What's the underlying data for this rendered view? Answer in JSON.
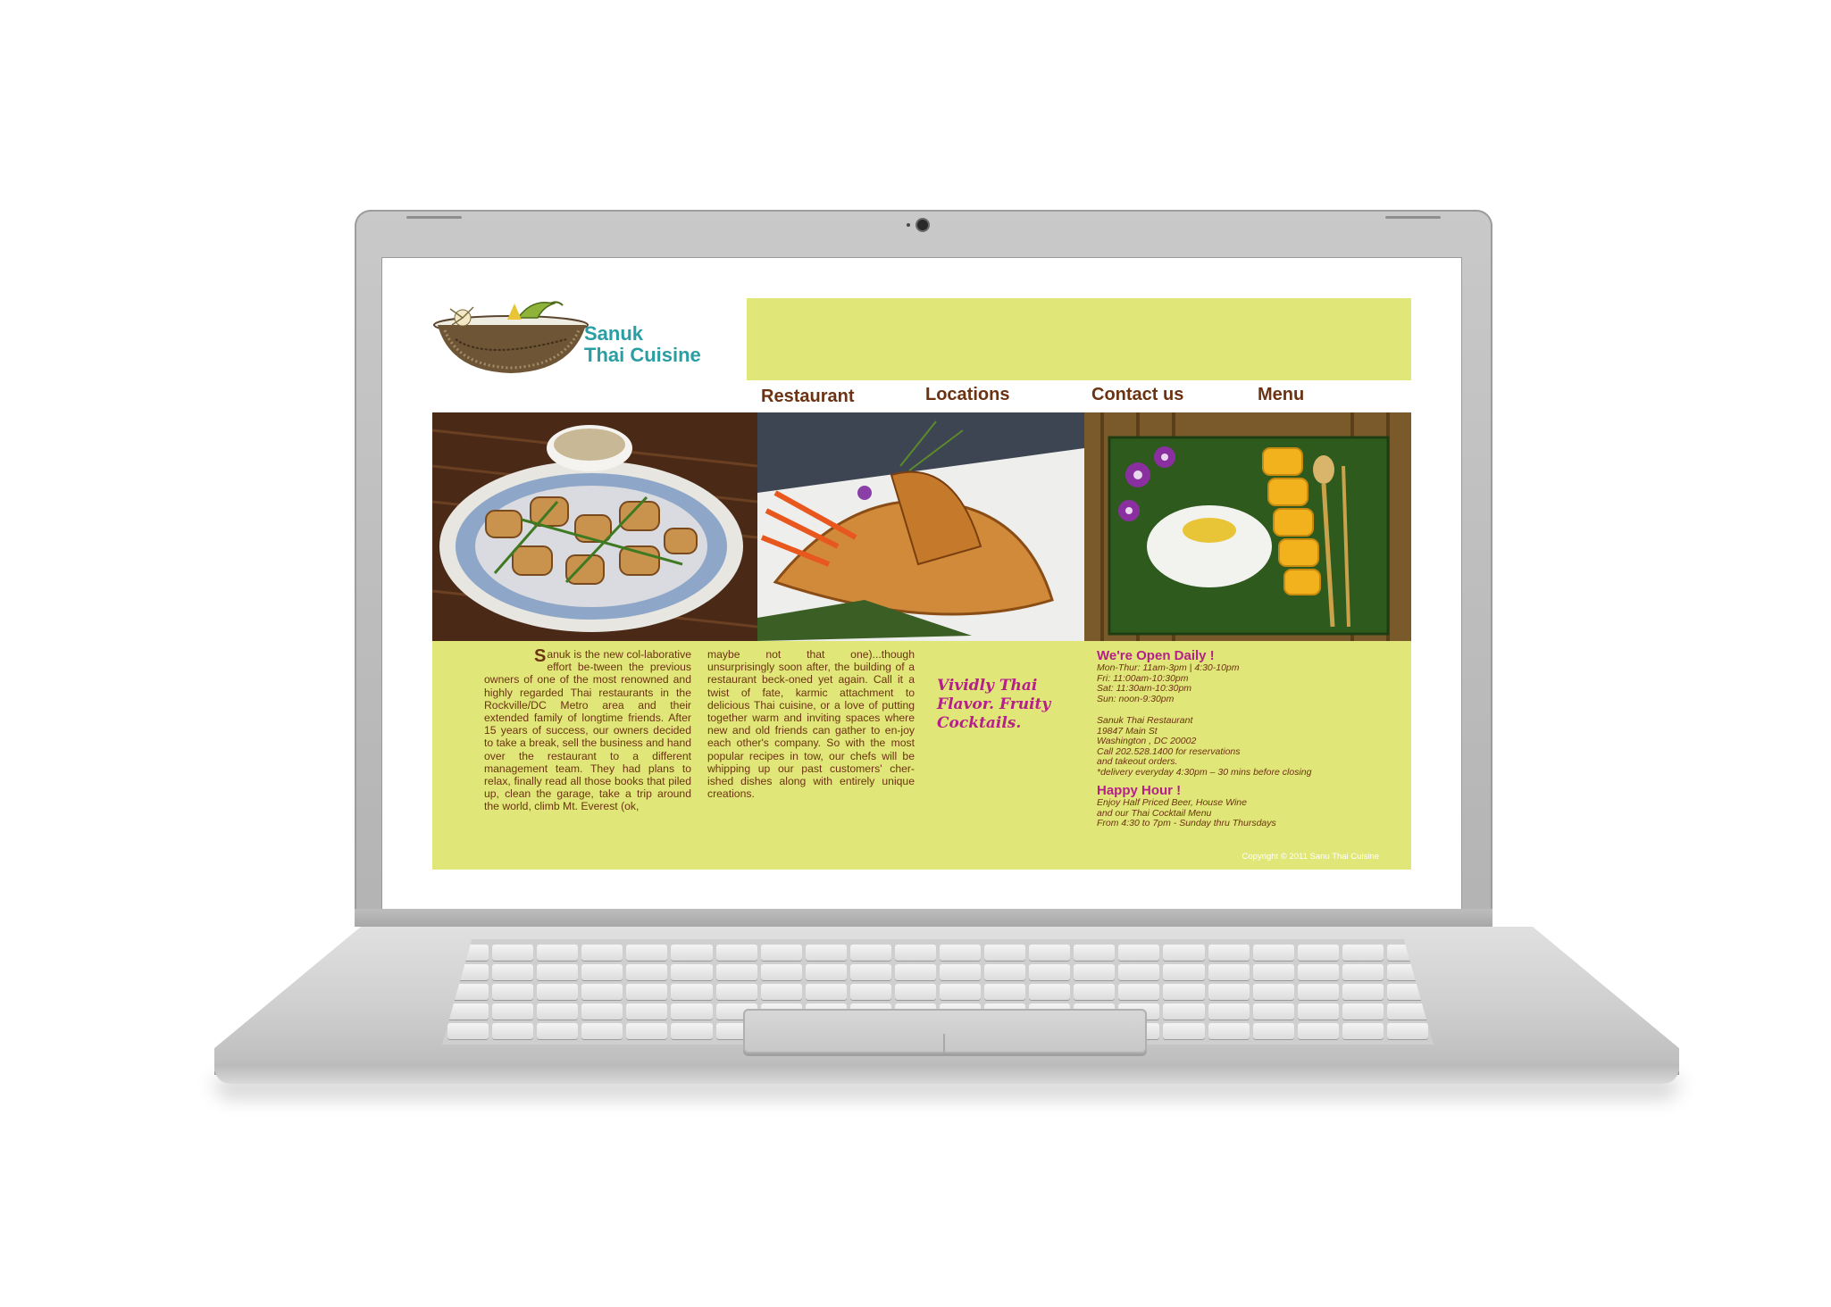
{
  "site": {
    "logo": {
      "line1": "Sanuk",
      "line2": "Thai Cuisine"
    },
    "nav": [
      {
        "label": "Restaurant"
      },
      {
        "label": "Locations"
      },
      {
        "label": "Contact us"
      },
      {
        "label": "Menu"
      }
    ],
    "intro": {
      "dropcap": "S",
      "col1": "anuk is the new col-laborative effort be-tween the previous owners of one of the most renowned and highly regarded Thai restaurants in the Rockville/DC Metro area and their extended family of longtime friends. After 15 years of success, our owners decided to take a break, sell the business and hand over the restaurant to a different management team. They had plans to relax, finally read all those books that piled up, clean the garage, take a trip around the world, climb Mt. Everest (ok,",
      "col2": "maybe not that one)...though unsurprisingly soon after, the building of a restaurant beck-oned yet again. Call it a twist of fate, karmic attachment to delicious Thai cuisine, or a love of putting together warm and inviting spaces where new and old friends can gather to en-joy each other's company. So with the most popular recipes in tow, our chefs will be whipping up our past customers' cher-ished dishes along with entirely unique creations."
    },
    "tagline": "Vividly Thai Flavor. Fruity Cocktails.",
    "hours": {
      "title": "We're Open Daily !",
      "lines": [
        "Mon-Thur: 11am-3pm | 4:30-10pm",
        "Fri: 11:00am-10:30pm",
        "Sat: 11:30am-10:30pm",
        "Sun: noon-9:30pm"
      ]
    },
    "address": {
      "lines": [
        "Sanuk Thai Restaurant",
        "19847 Main St",
        "Washington , DC 20002",
        "Call 202.528.1400 for reservations",
        "and takeout orders.",
        "*delivery everyday 4:30pm – 30 mins before closing"
      ]
    },
    "happy_hour": {
      "title": "Happy Hour !",
      "lines": [
        "Enjoy Half Priced Beer, House Wine",
        "and our Thai Cocktail Menu",
        "From 4:30 to 7pm - Sunday thru Thursdays"
      ]
    },
    "copyright": "Copyright © 2011 Sanu Thai Cuisine"
  },
  "colors": {
    "accent_yellow": "#e1e679",
    "brand_teal": "#2b9ea3",
    "text_brown": "#6b3311",
    "highlight_magenta": "#b51f8a"
  },
  "photos": [
    {
      "icon": "grilled-chicken-photo"
    },
    {
      "icon": "fried-wonton-photo"
    },
    {
      "icon": "mango-sticky-rice-photo"
    }
  ]
}
